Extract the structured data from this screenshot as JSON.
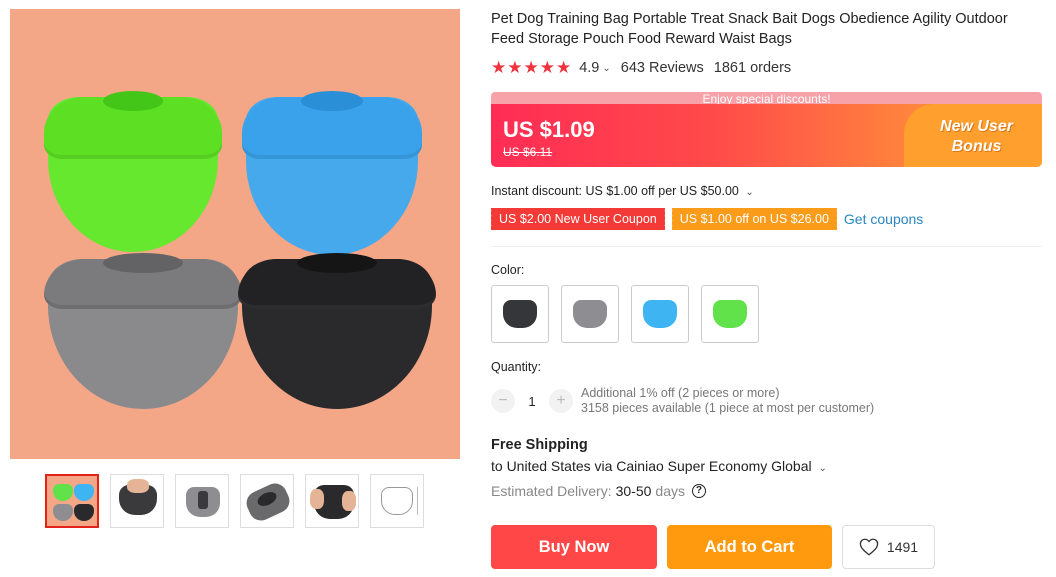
{
  "product": {
    "title": "Pet Dog Training Bag Portable Treat Snack Bait Dogs Obedience Agility Outdoor Feed Storage Pouch Food Reward Waist Bags",
    "rating": "4.9",
    "reviews": "643 Reviews",
    "orders": "1861 orders",
    "stars": "★★★★★"
  },
  "promo": {
    "banner": "Enjoy special discounts!",
    "price": "US $1.09",
    "old_price": "US $6.11",
    "bonus_line1": "New User",
    "bonus_line2": "Bonus"
  },
  "discounts": {
    "instant": "Instant discount: US $1.00 off per US $50.00",
    "coupon_1": "US $2.00 New User Coupon",
    "coupon_2": "US $1.00 off on US $26.00",
    "get_coupons": "Get coupons"
  },
  "color": {
    "label": "Color:",
    "options": [
      "#35363a",
      "#8e8e92",
      "#3fb4f2",
      "#62e24a"
    ]
  },
  "quantity": {
    "label": "Quantity:",
    "value": "1",
    "minus": "−",
    "plus": "+",
    "info_1": "Additional 1% off (2 pieces or more)",
    "info_2": "3158 pieces available (1 piece at most per customer)"
  },
  "shipping": {
    "title": "Free Shipping",
    "to": "to United States via Cainiao Super Economy Global",
    "delivery_label": "Estimated Delivery:",
    "delivery_days": "30-50",
    "delivery_unit": "days",
    "help": "?"
  },
  "actions": {
    "buy_now": "Buy Now",
    "add_to_cart": "Add to Cart",
    "wishlist_count": "1491"
  }
}
